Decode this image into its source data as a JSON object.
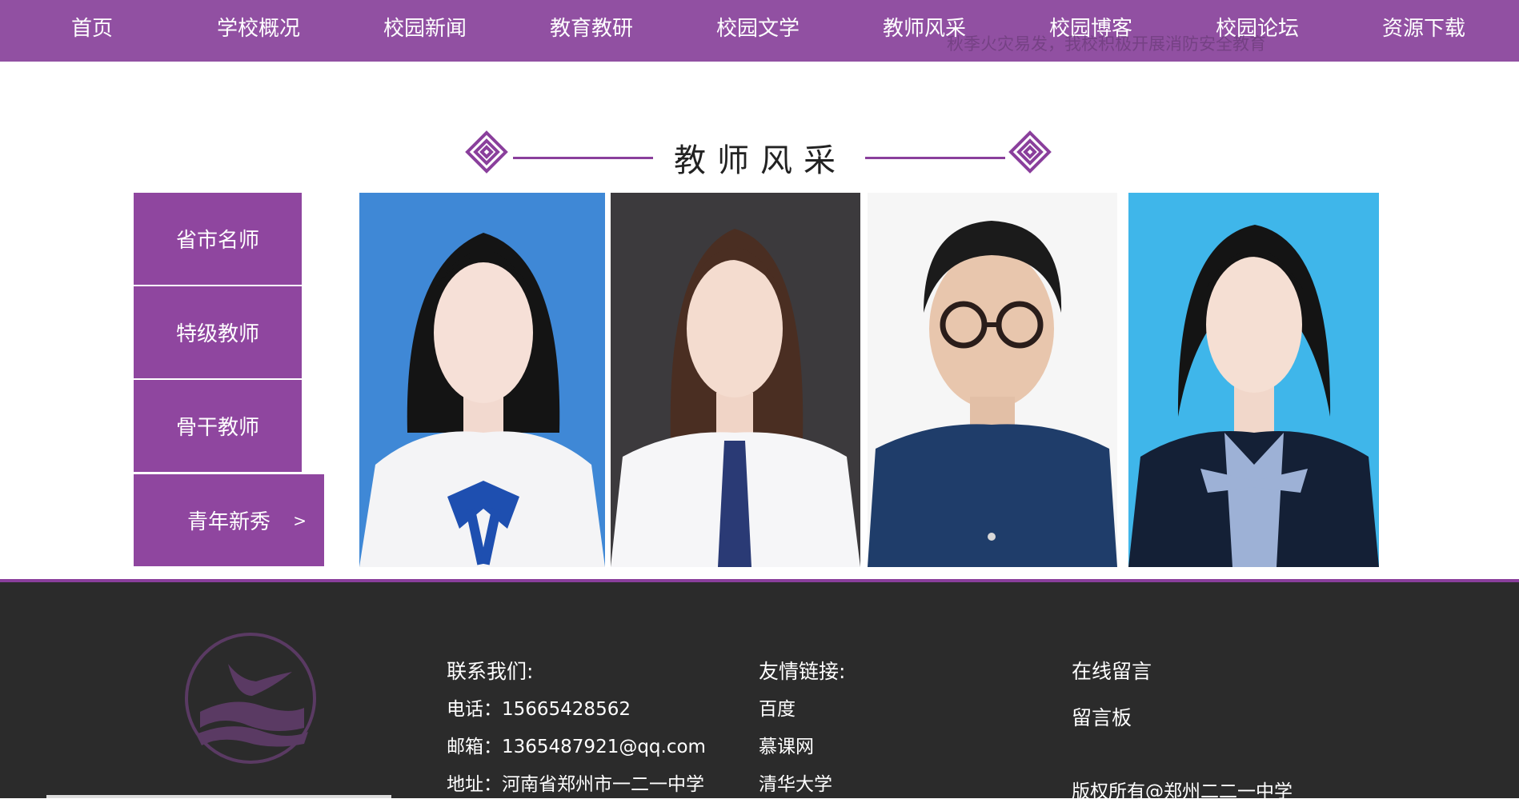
{
  "nav": {
    "items": [
      {
        "label": "首页"
      },
      {
        "label": "学校概况"
      },
      {
        "label": "校园新闻"
      },
      {
        "label": "教育教研"
      },
      {
        "label": "校园文学"
      },
      {
        "label": "教师风采"
      },
      {
        "label": "校园博客"
      },
      {
        "label": "校园论坛"
      },
      {
        "label": "资源下载"
      }
    ],
    "ticker": "秋季火灾易发，我校积极开展消防安全教育"
  },
  "section": {
    "title": "教师风采"
  },
  "categories": [
    {
      "label": "省市名师"
    },
    {
      "label": "特级教师"
    },
    {
      "label": "骨干教师"
    },
    {
      "label": "青年新秀",
      "arrow": ">"
    }
  ],
  "colors": {
    "brand_purple": "#9150a2",
    "footer_bg": "#2b2b2b"
  },
  "footer": {
    "contact": {
      "heading": "联系我们:",
      "phone": "电话：15665428562",
      "email": "邮箱：1365487921@qq.com",
      "address": "地址：河南省郑州市一二一中学"
    },
    "links": {
      "heading": "友情链接:",
      "items": [
        "百度",
        "慕课网",
        "清华大学"
      ]
    },
    "message": {
      "online": "在线留言",
      "board": "留言板"
    },
    "copyright": "版权所有@郑州二二一中学"
  }
}
